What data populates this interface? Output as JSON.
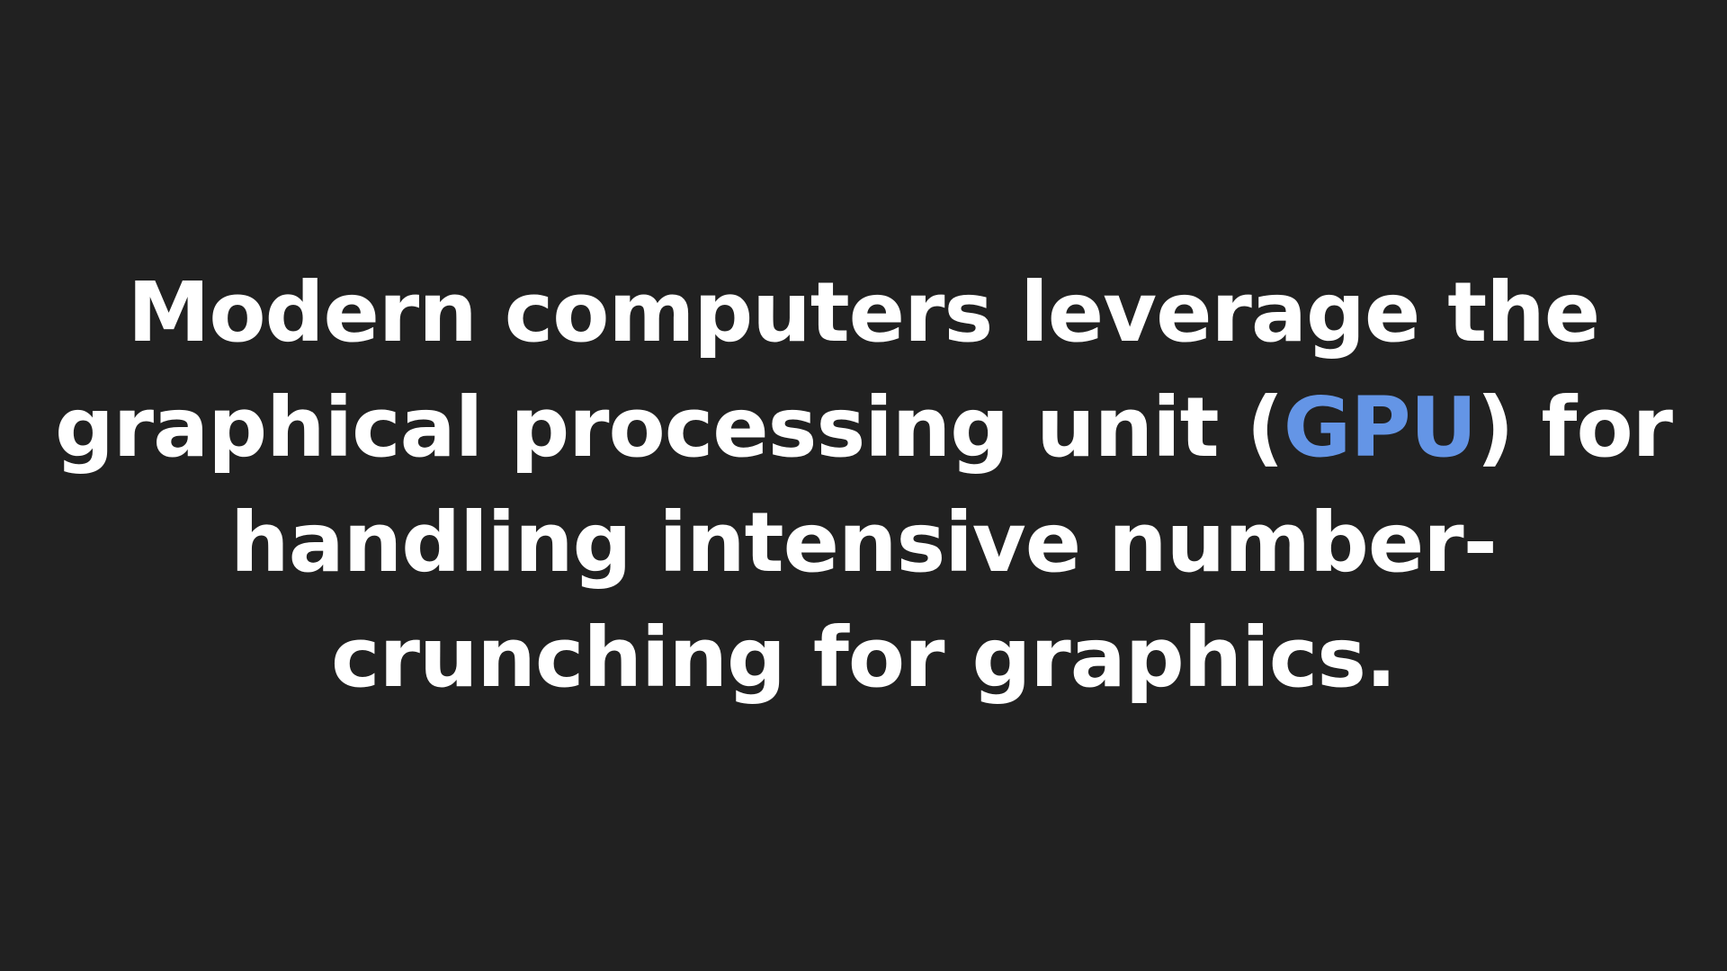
{
  "slide": {
    "background_color": "#212121",
    "text_color": "#ffffff",
    "accent_color": "#6495e6",
    "statement": {
      "line1": "Modern computers leverage the",
      "line2_before": "graphical processing unit (",
      "line2_highlight": "GPU",
      "line2_after": ") for",
      "line3": "handling intensive number-",
      "line4": "crunching for graphics."
    }
  }
}
